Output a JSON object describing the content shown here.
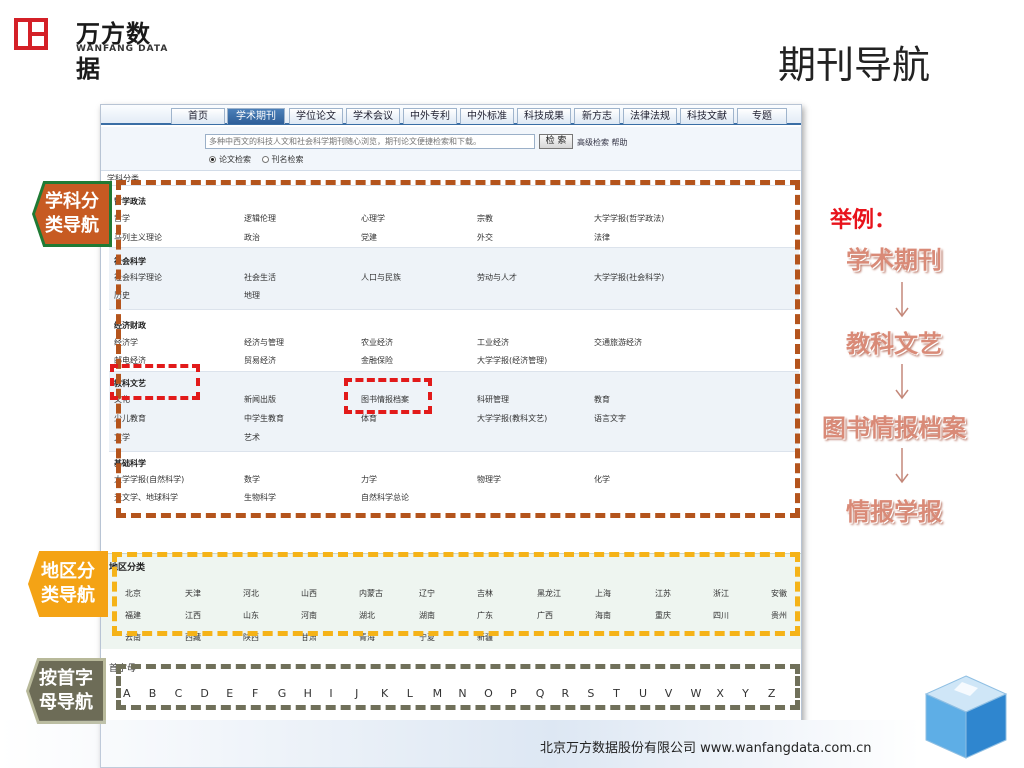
{
  "logo": {
    "cn": "万方数据",
    "en": "WANFANG DATA"
  },
  "slide_title": "期刊导航",
  "nav_tabs": [
    "首页",
    "学术期刊",
    "学位论文",
    "学术会议",
    "中外专利",
    "中外标准",
    "科技成果",
    "新方志",
    "法律法规",
    "科技文献",
    "专题"
  ],
  "search": {
    "placeholder": "多种中西文的科技人文和社会科学期刊随心浏览，期刊论文便捷检索和下载。",
    "button": "检 索",
    "links": "高级检索  帮助",
    "radio_1": "论文检索",
    "radio_2": "刊名检索"
  },
  "subject_head": "学科分类",
  "subjects": [
    {
      "title": "哲学政法",
      "row1": [
        "哲学",
        "逻辑伦理",
        "心理学",
        "宗教",
        "大学学报(哲学政法)"
      ],
      "row2": [
        "马列主义理论",
        "政治",
        "党建",
        "外交",
        "法律"
      ]
    },
    {
      "title": "社会科学",
      "row1": [
        "社会科学理论",
        "社会生活",
        "人口与民族",
        "劳动与人才",
        "大学学报(社会科学)"
      ],
      "row2": [
        "历史",
        "地理",
        "",
        "",
        ""
      ]
    },
    {
      "title": "经济财政",
      "row1": [
        "经济学",
        "经济与管理",
        "农业经济",
        "工业经济",
        "交通旅游经济"
      ],
      "row2": [
        "邮电经济",
        "贸易经济",
        "金融保险",
        "大学学报(经济管理)",
        ""
      ]
    },
    {
      "title": "教科文艺",
      "row1": [
        "文化",
        "新闻出版",
        "图书情报档案",
        "科研管理",
        "教育"
      ],
      "row2": [
        "少儿教育",
        "中学生教育",
        "体育",
        "大学学报(教科文艺)",
        "语言文字"
      ],
      "row3": [
        "文学",
        "艺术",
        "",
        "",
        ""
      ]
    },
    {
      "title": "基础科学",
      "row1": [
        "大学学报(自然科学)",
        "数学",
        "力学",
        "物理学",
        "化学"
      ],
      "row2": [
        "天文学、地球科学",
        "生物科学",
        "自然科学总论",
        "",
        ""
      ]
    }
  ],
  "region_head": "地区分类",
  "regions": [
    [
      "北京",
      "天津",
      "河北",
      "山西",
      "内蒙古",
      "辽宁",
      "吉林",
      "黑龙江",
      "上海",
      "江苏",
      "浙江",
      "安徽"
    ],
    [
      "福建",
      "江西",
      "山东",
      "河南",
      "湖北",
      "湖南",
      "广东",
      "广西",
      "海南",
      "重庆",
      "四川",
      "贵州"
    ],
    [
      "云南",
      "西藏",
      "陕西",
      "甘肃",
      "青海",
      "宁夏",
      "新疆",
      "",
      "",
      "",
      "",
      ""
    ]
  ],
  "letter_head": "首字母",
  "letters": [
    "A",
    "B",
    "C",
    "D",
    "E",
    "F",
    "G",
    "H",
    "I",
    "J",
    "K",
    "L",
    "M",
    "N",
    "O",
    "P",
    "Q",
    "R",
    "S",
    "T",
    "U",
    "V",
    "W",
    "X",
    "Y",
    "Z"
  ],
  "labels": {
    "subject": "学科分类导航",
    "region": "地区分类导航",
    "letter": "按首字母导航"
  },
  "example": {
    "title": "举例：",
    "chain": [
      "学术期刊",
      "教科文艺",
      "图书情报档案",
      "情报学报"
    ]
  },
  "footer": "北京万方数据股份有限公司   www.wanfangdata.com.cn",
  "colors": {
    "subject": "#c75a22",
    "region": "#f4a315",
    "letter": "#6d6c57",
    "highlight": "#e21a1a",
    "example": "#e8131b"
  }
}
